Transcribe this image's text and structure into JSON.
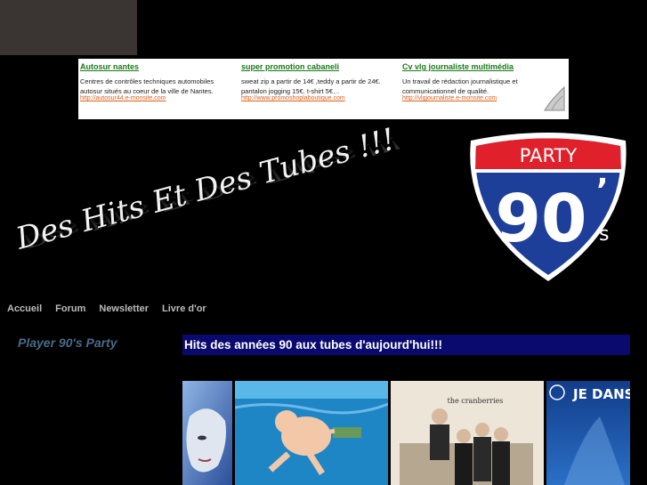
{
  "ads": [
    {
      "title": "Autosur nantes",
      "text": "Centres de contrôles techniques automobiles autosur situés au coeur de la ville de Nantes.",
      "url": "http://autosur44.e-monsite.com"
    },
    {
      "title": "super promotion cabaneli",
      "text": "sweat zip a partir de 14€ ,teddy a partir de 24€. pantalon jogging 15€. t-shirt 5€…",
      "url": "http://www.promoshoplaboutique.com"
    },
    {
      "title": "Cv vlg journaliste multimédia",
      "text": "Un travail de rédaction journalistique et communicationnel de qualité.",
      "url": "http://vlgjournaliste.e-monsite.com"
    }
  ],
  "banner": {
    "slogan": "Des Hits Et Des Tubes !!!",
    "logo_top": "PARTY",
    "logo_number": "90",
    "logo_suffix": "s",
    "logo_apostrophe": "’"
  },
  "nav": [
    "Accueil",
    "Forum",
    "Newsletter",
    "Livre d'or"
  ],
  "sidebar": {
    "title": "Player 90's Party"
  },
  "content": {
    "heading": "Hits des années 90 aux tubes d'aujourd'hui!!!"
  },
  "covers": {
    "cranberries_band": "the cranberries",
    "je_dans": "JE DANS"
  },
  "colors": {
    "background": "#000000",
    "ad_title": "#1a7a1a",
    "ad_url": "#d9601a",
    "heading_bar": "#0a0a6e",
    "shield_blue": "#1d3f9a",
    "shield_red": "#e0202a"
  }
}
